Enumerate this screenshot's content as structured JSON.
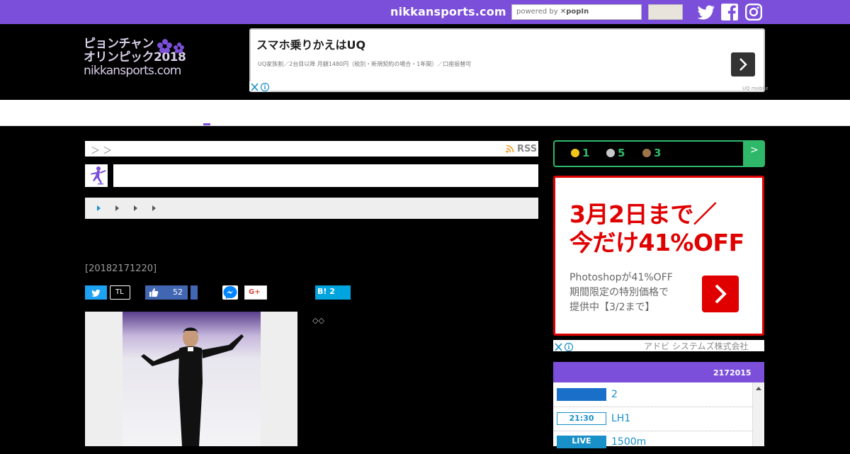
{
  "topbar": {
    "site_name": "nikkansports.com",
    "search_placeholder_prefix": "powered by",
    "search_placeholder_brand": "popIn",
    "social_icons": [
      "twitter-icon",
      "facebook-icon",
      "instagram-icon"
    ]
  },
  "header": {
    "logo_line1": "ピョンチャン",
    "logo_line2": "オリンピック2018",
    "logo_line3": "nikkansports.com"
  },
  "top_ad": {
    "title": "スマホ乗りかえはUQ",
    "subtitle": "UQ家族割／2台目以降 月額1480円（税別・新規契約の場合・1年間）／口座振替可",
    "sponsor": "UQ mobile"
  },
  "breadcrumb": {
    "text": "＞ ＞",
    "rss_label": "RSS"
  },
  "article": {
    "timestamp": "[20182171220]",
    "like_count": "52",
    "tl_label": "TL",
    "gplus_label": "G+",
    "hatena_label": "B! 2",
    "caption_marks": "◇◇"
  },
  "medals": {
    "gold": "1",
    "silver": "5",
    "bronze": "3",
    "next_label": ">",
    "colors": {
      "gold": "#f3c51a",
      "silver": "#c8c8c8",
      "bronze": "#a0744b",
      "accent": "#2fb86a"
    }
  },
  "side_ad": {
    "headline_line1": "3月2日まで／",
    "headline_line2": "今だけ41%OFF",
    "body_line1": "Photoshopが41%OFF",
    "body_line2": "期間限定の特別価格で",
    "body_line3": "提供中【3/2まで】",
    "sponsor": "アドビ システムズ株式会社"
  },
  "schedule": {
    "date": "2172015",
    "rows": [
      {
        "badge": "",
        "text": "2"
      },
      {
        "badge": "21:30",
        "text": "LH1"
      },
      {
        "badge": "LIVE",
        "text": "1500m"
      }
    ]
  },
  "colors": {
    "brand": "#7b4fd9",
    "ad_red": "#e00000",
    "link_blue": "#1a90c8"
  }
}
